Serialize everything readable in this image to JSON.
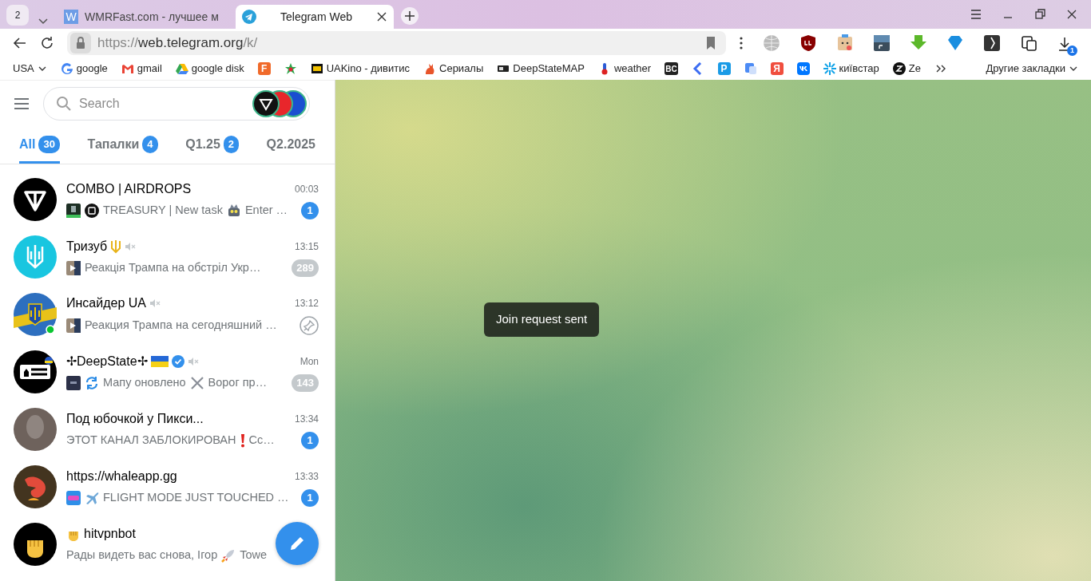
{
  "browser": {
    "tab_counter": "2",
    "tabs": [
      {
        "title": "WMRFast.com - лучшее м",
        "glyph": "W",
        "selected": false
      },
      {
        "title": "Telegram Web",
        "selected": true
      }
    ],
    "url": {
      "scheme": "https://",
      "host": "web.telegram.org",
      "path": "/k/"
    },
    "downloads_badge": "1",
    "bookmarks": [
      {
        "label": "USA",
        "kind": "folder"
      },
      {
        "label": "google",
        "kind": "link"
      },
      {
        "label": "gmail",
        "kind": "link"
      },
      {
        "label": "google disk",
        "kind": "link"
      },
      {
        "glyph": "F",
        "kind": "link"
      },
      {
        "kind": "link"
      },
      {
        "label": "UAKino - дивитис",
        "kind": "link"
      },
      {
        "label": "Сериалы",
        "kind": "link"
      },
      {
        "label": "DeepStateMAP",
        "kind": "link"
      },
      {
        "label": "weather",
        "kind": "link"
      },
      {
        "glyph": "BC",
        "kind": "link"
      },
      {
        "kind": "link"
      },
      {
        "glyph": "P",
        "kind": "link"
      },
      {
        "kind": "link"
      },
      {
        "glyph": "Я",
        "kind": "link"
      },
      {
        "kind": "link"
      },
      {
        "label": "київстар",
        "kind": "link"
      },
      {
        "label": "Ze",
        "kind": "link"
      },
      {
        "kind": "link"
      },
      {
        "label": "Другие закладки",
        "kind": "folder"
      }
    ]
  },
  "sidebar": {
    "search": {
      "placeholder": "Search"
    },
    "folders": [
      {
        "label": "All",
        "count": "30",
        "selected": true
      },
      {
        "label": "Тапалки",
        "count": "4",
        "selected": false
      },
      {
        "label": "Q1.25",
        "count": "2",
        "selected": false
      },
      {
        "label": "Q2.2025",
        "selected": false
      }
    ],
    "chats": [
      {
        "title": "COMBO | AIRDROPS",
        "time": "00:03",
        "muted": false,
        "pinned": false,
        "verified": false,
        "online": false,
        "unread": "1",
        "preview": [
          {
            "kind": "thumb"
          },
          {
            "kind": "logo"
          },
          {
            "kind": "text",
            "text": "TREASURY | New task"
          },
          {
            "kind": "robot"
          },
          {
            "kind": "text",
            "text": "Enter …"
          }
        ]
      },
      {
        "title": "Тризуб",
        "time": "13:15",
        "muted": true,
        "pinned": false,
        "verified": false,
        "online": false,
        "unread": "289",
        "preview": [
          {
            "kind": "video"
          },
          {
            "kind": "text",
            "text": "Реакція Трампа на обстріл Укр…"
          }
        ]
      },
      {
        "title": "Инсайдер UA",
        "time": "13:12",
        "muted": true,
        "pinned": true,
        "verified": false,
        "online": true,
        "preview": [
          {
            "kind": "video"
          },
          {
            "kind": "text",
            "text": "Реакция Трампа на сегодняшний …"
          }
        ]
      },
      {
        "title": "✢DeepState✢",
        "time": "Mon",
        "muted": true,
        "pinned": false,
        "verified": true,
        "online": false,
        "unread": "143",
        "preview": [
          {
            "kind": "thumb-dark"
          },
          {
            "kind": "sync"
          },
          {
            "kind": "text",
            "text": "Мапу оновлено"
          },
          {
            "kind": "swords"
          },
          {
            "kind": "text",
            "text": "Ворог пр…"
          }
        ]
      },
      {
        "title": "Под юбочкой у Пикси...",
        "time": "13:34",
        "muted": false,
        "pinned": false,
        "verified": false,
        "online": false,
        "unread": "1",
        "preview": [
          {
            "kind": "text",
            "text": "ЭТОТ КАНАЛ ЗАБЛОКИРОВАН"
          },
          {
            "kind": "exclaim"
          },
          {
            "kind": "text",
            "text": "Сс…"
          }
        ]
      },
      {
        "title": "https://whaleapp.gg",
        "time": "13:33",
        "muted": false,
        "pinned": false,
        "verified": false,
        "online": false,
        "unread": "1",
        "preview": [
          {
            "kind": "game-thumb"
          },
          {
            "kind": "plane"
          },
          {
            "kind": "text",
            "text": "FLIGHT MODE JUST TOUCHED …"
          }
        ]
      },
      {
        "title": "hitvpnbot",
        "muted": false,
        "pinned": false,
        "verified": false,
        "online": false,
        "preview": [
          {
            "kind": "text",
            "text": "Рады видеть вас снова, Ігор"
          },
          {
            "kind": "rocket"
          },
          {
            "kind": "text",
            "text": "Towe"
          }
        ]
      }
    ]
  },
  "toast": "Join request sent"
}
